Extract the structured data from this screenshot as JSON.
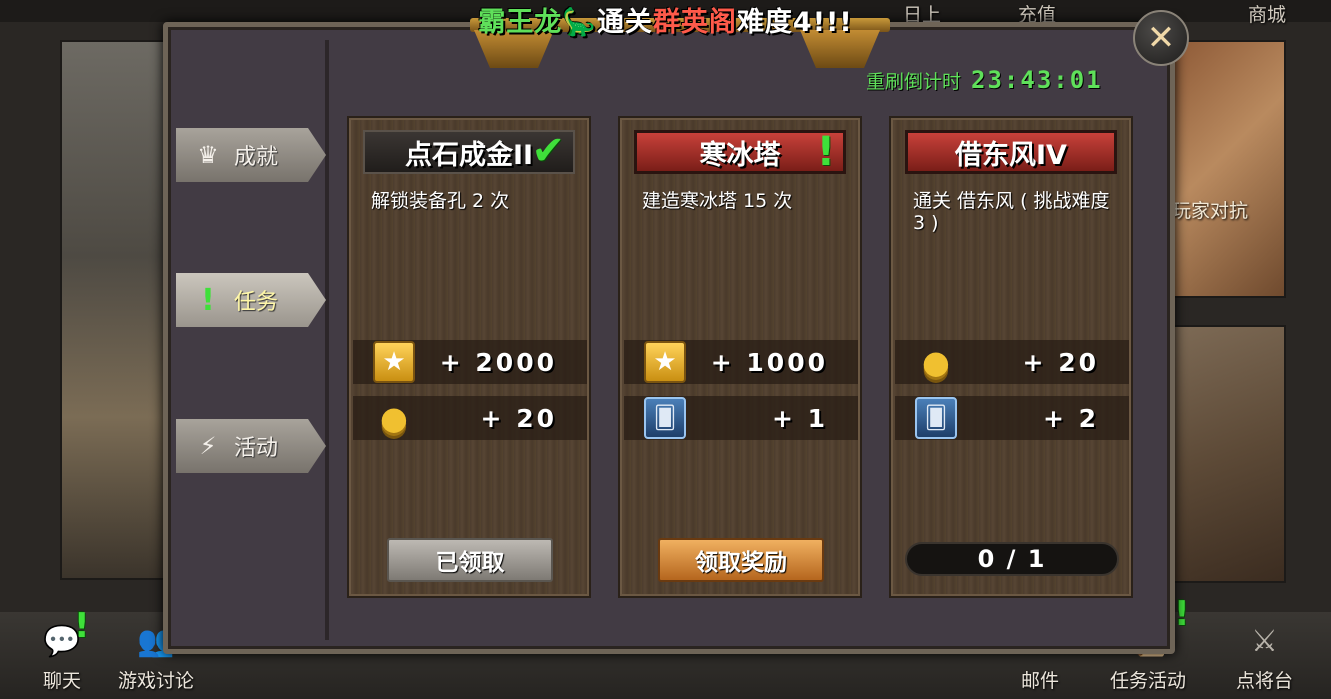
{
  "banner": {
    "part1": "霸王龙",
    "part2": "🦕",
    "part3": "通关",
    "part4": "群英阁",
    "part5": "难度4!!!"
  },
  "refresh": {
    "label": "重刷倒计时",
    "timer": "23:43:01"
  },
  "top_tabs": [
    "日上",
    "充值",
    "商城"
  ],
  "background": {
    "pvp_label": "玩家对抗"
  },
  "side_tabs": [
    {
      "label": "成就",
      "icon": "crown-icon"
    },
    {
      "label": "任务",
      "icon": "exclamation-icon",
      "active": true
    },
    {
      "label": "活动",
      "icon": "lightning-icon"
    }
  ],
  "cards": [
    {
      "title": "点石成金II",
      "status_mark": "✔",
      "desc": "解锁装备孔 2 次",
      "rewards": [
        {
          "icon": "star-icon",
          "value": "+ 2000"
        },
        {
          "icon": "coin-icon",
          "value": "+ 20"
        }
      ],
      "button": "已领取"
    },
    {
      "title": "寒冰塔",
      "status_mark": "!",
      "desc": "建造寒冰塔 15 次",
      "rewards": [
        {
          "icon": "star-icon",
          "value": "+ 1000"
        },
        {
          "icon": "card-icon",
          "value": "+ 1"
        }
      ],
      "button": "领取奖励"
    },
    {
      "title": "借东风IV",
      "desc": "通关 借东风 ( 挑战难度 3 )",
      "rewards": [
        {
          "icon": "coin-icon",
          "value": "+ 20"
        },
        {
          "icon": "card-icon",
          "value": "+ 2"
        }
      ],
      "progress": "0 / 1"
    }
  ],
  "bottom_bar": [
    {
      "label": "聊天",
      "icon": "chat-icon",
      "alert": true
    },
    {
      "label": "游戏讨论",
      "icon": "discussion-icon"
    },
    {
      "label": "邮件",
      "icon": "mail-icon"
    },
    {
      "label": "任务活动",
      "icon": "quest-icon",
      "alert": true
    },
    {
      "label": "点将台",
      "icon": "recruit-icon"
    }
  ],
  "colors": {
    "green": "#5fe05a",
    "red": "#ff5a4a",
    "panel": "#423b44"
  }
}
